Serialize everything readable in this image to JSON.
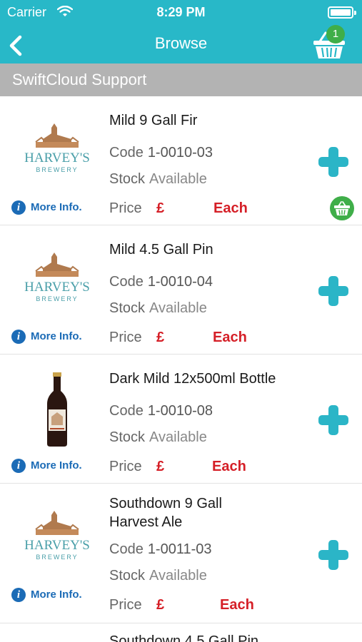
{
  "status": {
    "carrier": "Carrier",
    "time": "8:29 PM"
  },
  "nav": {
    "title": "Browse",
    "cart_count": "1"
  },
  "section": {
    "title": "SwiftCloud Support"
  },
  "labels": {
    "code": "Code",
    "stock": "Stock",
    "price": "Price",
    "more_info": "More Info.",
    "brand_line1": "HARVEY'S",
    "brand_line2": "BREWERY"
  },
  "products": [
    {
      "name": "Mild 9 Gall Fir",
      "code": "1-0010-03",
      "stock": "Available",
      "price_symbol": "£",
      "unit": "Each",
      "in_cart": true
    },
    {
      "name": "Mild 4.5 Gall Pin",
      "code": "1-0010-04",
      "stock": "Available",
      "price_symbol": "£",
      "unit": "Each",
      "in_cart": false
    },
    {
      "name": "Dark Mild 12x500ml Bottle",
      "code": "1-0010-08",
      "stock": "Available",
      "price_symbol": "£",
      "unit": "Each",
      "in_cart": false
    },
    {
      "name": "Southdown 9 Gall Harvest Ale",
      "code": "1-0011-03",
      "stock": "Available",
      "price_symbol": "£",
      "unit": "Each",
      "in_cart": false
    },
    {
      "name": "Southdown 4.5 Gall Pin"
    }
  ],
  "colors": {
    "header": "#28b8c8",
    "section": "#b3b3b3",
    "price": "#d51f27",
    "link": "#1b6bb6",
    "plus": "#2bb5c7",
    "cart_badge": "#3fae49"
  }
}
